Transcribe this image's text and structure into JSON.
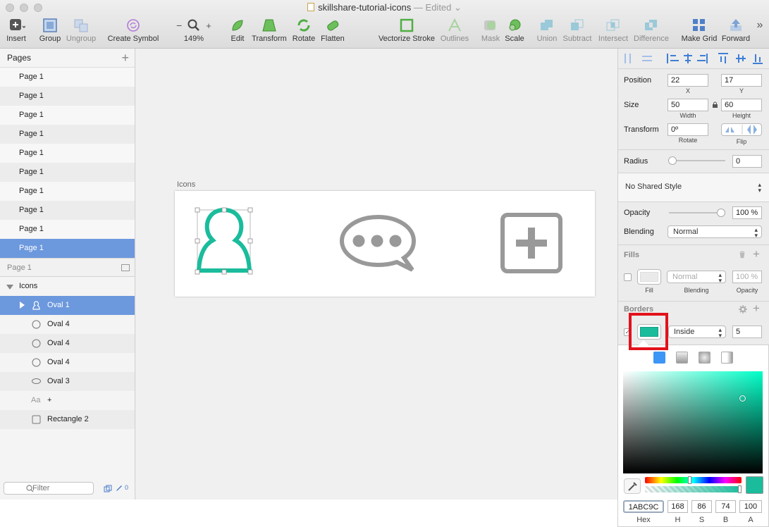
{
  "window": {
    "title": "skillshare-tutorial-icons",
    "status": "— Edited ⌄"
  },
  "toolbar": {
    "insert": "Insert",
    "group": "Group",
    "ungroup": "Ungroup",
    "create_symbol": "Create Symbol",
    "zoom_minus": "−",
    "zoom_plus": "+",
    "zoom": "149%",
    "edit": "Edit",
    "transform": "Transform",
    "rotate": "Rotate",
    "flatten": "Flatten",
    "vectorize_stroke": "Vectorize Stroke",
    "outlines": "Outlines",
    "mask": "Mask",
    "scale": "Scale",
    "union": "Union",
    "subtract": "Subtract",
    "intersect": "Intersect",
    "difference": "Difference",
    "make_grid": "Make Grid",
    "forward": "Forward",
    "more": "»"
  },
  "pages": {
    "header": "Pages",
    "add": "+",
    "items": [
      "Page 1",
      "Page 1",
      "Page 1",
      "Page 1",
      "Page 1",
      "Page 1",
      "Page 1",
      "Page 1",
      "Page 1",
      "Page 1"
    ],
    "selected_index": 9
  },
  "layers": {
    "page_label": "Page 1",
    "group": "Icons",
    "items": [
      {
        "label": "Oval 1",
        "icon": "person-icon",
        "selected": true
      },
      {
        "label": "Oval 4",
        "icon": "oval-icon"
      },
      {
        "label": "Oval 4",
        "icon": "oval-icon"
      },
      {
        "label": "Oval 4",
        "icon": "oval-icon"
      },
      {
        "label": "Oval 3",
        "icon": "speech-bubble-icon"
      },
      {
        "label": "+",
        "icon": "text-icon",
        "icon_text": "Aa"
      },
      {
        "label": "Rectangle 2",
        "icon": "rectangle-icon"
      }
    ],
    "filter_placeholder": "Filter",
    "filter_count": "0"
  },
  "canvas": {
    "artboard_label": "Icons",
    "accent": "#1ABC9C",
    "icon_gray": "#999999"
  },
  "inspector": {
    "position_label": "Position",
    "x": "22",
    "y": "17",
    "x_label": "X",
    "y_label": "Y",
    "size_label": "Size",
    "width": "50",
    "height": "60",
    "width_label": "Width",
    "height_label": "Height",
    "transform_label": "Transform",
    "rotate": "0º",
    "rotate_label": "Rotate",
    "flip_label": "Flip",
    "radius_label": "Radius",
    "radius": "0",
    "shared_style": "No Shared Style",
    "opacity_label": "Opacity",
    "opacity": "100 %",
    "blending_label": "Blending",
    "blending": "Normal",
    "fills_title": "Fills",
    "fill_label": "Fill",
    "fill_blending": "Normal",
    "fill_blending_label": "Blending",
    "fill_opacity": "100 %",
    "fill_opacity_label": "Opacity",
    "borders_title": "Borders",
    "border_position": "Inside",
    "border_thickness": "5",
    "border_color": "#1ABC9C"
  },
  "picker": {
    "hex": "1ABC9C",
    "h": "168",
    "s": "86",
    "b": "74",
    "a": "100",
    "hex_label": "Hex",
    "h_label": "H",
    "s_label": "S",
    "b_label": "B",
    "a_label": "A",
    "color": "#1ABC9C"
  }
}
